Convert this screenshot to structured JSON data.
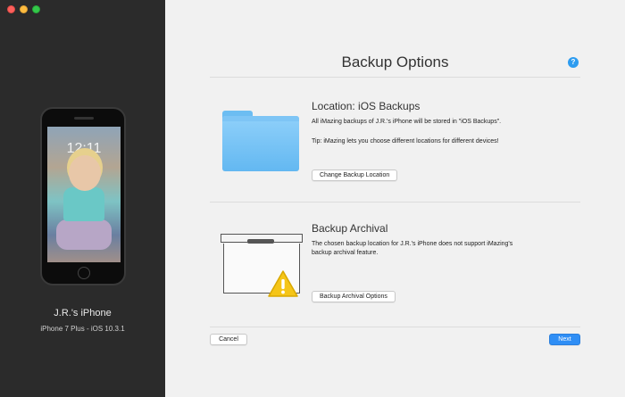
{
  "window": {
    "traffic_lights": [
      "close",
      "minimize",
      "zoom"
    ]
  },
  "sidebar": {
    "device_name": "J.R.'s iPhone",
    "device_info": "iPhone 7 Plus - iOS 10.3.1",
    "lock_time": "12:11"
  },
  "main": {
    "title": "Backup Options",
    "help_icon": "?",
    "location": {
      "heading": "Location: iOS Backups",
      "description": "All iMazing backups of J.R.'s iPhone will be stored in \"iOS Backups\".",
      "tip": "Tip: iMazing lets you choose different locations for different devices!",
      "button": "Change Backup Location",
      "icon": "folder-icon"
    },
    "archival": {
      "heading": "Backup Archival",
      "description_line1": "The chosen backup location for J.R.'s iPhone does not support iMazing's",
      "description_line2": "backup archival feature.",
      "button": "Backup Archival Options",
      "icon": "archive-box-warning-icon"
    },
    "footer": {
      "cancel": "Cancel",
      "next": "Next"
    }
  },
  "colors": {
    "sidebar_bg": "#2b2b2b",
    "main_bg": "#f1f1f1",
    "accent": "#2f8ef5",
    "folder": "#63b8f1",
    "warning": "#f5c518"
  }
}
